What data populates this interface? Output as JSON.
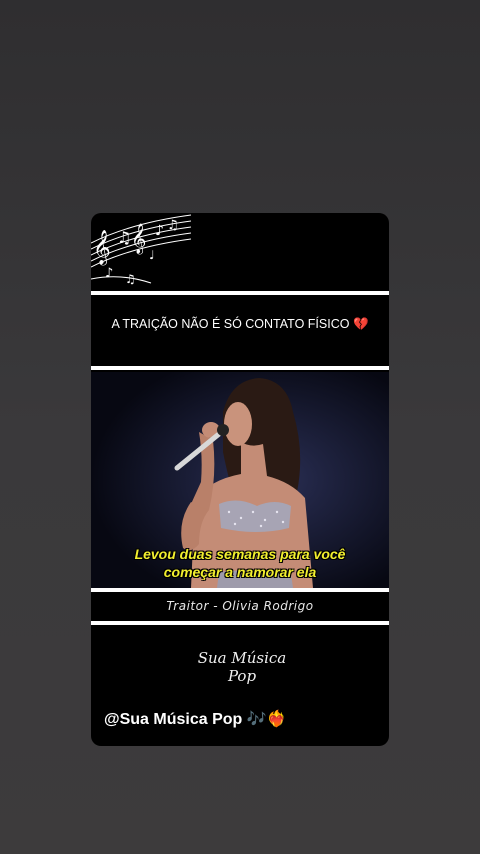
{
  "post": {
    "headline": "A TRAIÇÃO NÃO É SÓ CONTATO FÍSICO",
    "headline_emoji": "💔",
    "subtitle_line1": "Levou duas semanas para você",
    "subtitle_line2": "começar a namorar ela",
    "song_credit": "Traitor - Olivia Rodrigo",
    "logo_line1": "Sua Música",
    "logo_line2": "Pop",
    "handle": "@Sua Música Pop",
    "handle_emojis": "🎶❤️‍🔥"
  },
  "colors": {
    "background": "#3a3839",
    "card": "#000000",
    "subtitle": "#f2ef2f",
    "divider": "#ffffff"
  },
  "icons": [
    "music-notes-icon",
    "microphone-icon",
    "broken-heart-icon"
  ]
}
